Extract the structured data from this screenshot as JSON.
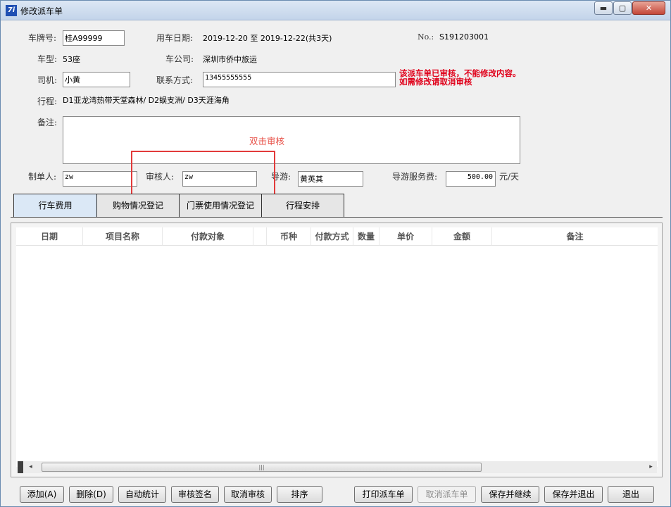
{
  "window": {
    "title": "修改派车单",
    "min": "▬",
    "max": "▢",
    "close": "✕"
  },
  "form": {
    "plate_label": "车牌号:",
    "plate_value": "桂A99999",
    "date_label": "用车日期:",
    "date_value": "2019-12-20 至 2019-12-22(共3天)",
    "no_label": "No.:",
    "no_value": "S191203001",
    "model_label": "车型:",
    "model_value": "53座",
    "company_label": "车公司:",
    "company_value": "深圳市侨中旅运",
    "driver_label": "司机:",
    "driver_value": "小黄",
    "contact_label": "联系方式:",
    "contact_value": "13455555555",
    "notice_line1": "该派车单已审核，不能修改内容。",
    "notice_line2": "如需修改请取消审核",
    "route_label": "行程:",
    "route_value": "D1亚龙湾热带天堂森林/ D2蜈支洲/ D3天涯海角",
    "remark_label": "备注:",
    "remark_hint": "双击审核",
    "maker_label": "制单人:",
    "maker_value": "zw",
    "auditor_label": "审核人:",
    "auditor_value": "zw",
    "guide_label": "导游:",
    "guide_value": "黄英其",
    "guide_fee_label": "导游服务费:",
    "guide_fee_value": "500.00",
    "guide_fee_unit": "元/天"
  },
  "tabs": [
    {
      "label": "行车费用",
      "active": true
    },
    {
      "label": "购物情况登记",
      "active": false
    },
    {
      "label": "门票使用情况登记",
      "active": false
    },
    {
      "label": "行程安排",
      "active": false
    }
  ],
  "table": {
    "columns": [
      "日期",
      "项目名称",
      "付款对象",
      "",
      "币种",
      "付款方式",
      "数量",
      "单价",
      "金额",
      "备注"
    ],
    "rows": []
  },
  "scrollbar": {
    "left": "◂",
    "right": "▸",
    "grip": "|||"
  },
  "buttons": {
    "add": "添加(A)",
    "delete": "删除(D)",
    "auto_stat": "自动统计",
    "audit_sign": "审核签名",
    "cancel_audit": "取消审核",
    "sort": "排序",
    "print": "打印派车单",
    "cancel_dispatch": "取消派车单",
    "save_continue": "保存并继续",
    "save_exit": "保存并退出",
    "exit": "退出"
  }
}
